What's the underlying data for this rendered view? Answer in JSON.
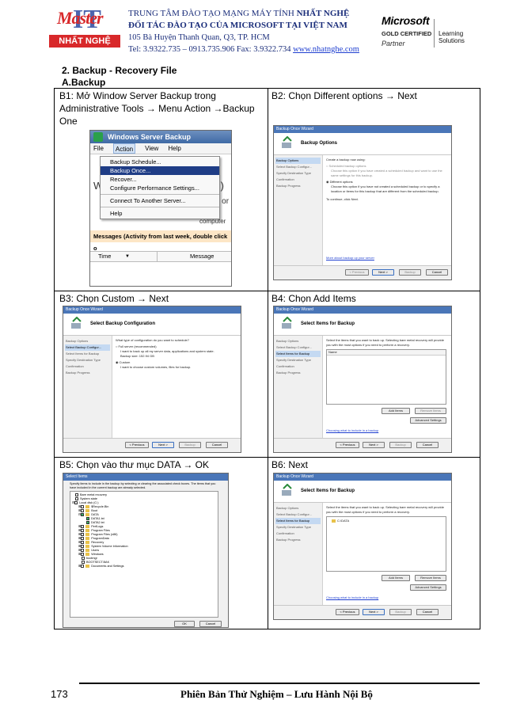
{
  "header": {
    "logo_small": "Master",
    "logo_mark": "IT",
    "logo_band": "NHẤT NGHỆ",
    "line1_prefix": "TRUNG TÂM ĐÀO TẠO MẠNG MÁY TÍNH ",
    "line1_bold": "NHẤT NGHỆ",
    "line2": "ĐỐI TÁC ĐÀO TẠO CỦA MICROSOFT TẠI VIỆT NAM",
    "line3": "105 Bà Huyện Thanh Quan, Q3, TP. HCM",
    "line4_prefix": "Tel: 3.9322.735 – 0913.735.906 Fax: 3.9322.734 ",
    "url": "www.nhatnghe.com",
    "ms_name": "Microsoft",
    "ms_gold": "GOLD CERTIFIED",
    "ms_partner": "Partner",
    "ms_ls": "Learning Solutions"
  },
  "section": {
    "title": "2. Backup - Recovery File",
    "subtitle": "A.Backup"
  },
  "cells": {
    "b1": "B1: Mở Window Server Backup trong Administrative Tools → Menu Action →Backup One",
    "b2": "B2: Chọn Different options → Next",
    "b3": "B3: Chọn Custom → Next",
    "b4": "B4: Chọn Add Items",
    "b5": "B5: Chọn vào thư mục DATA → OK",
    "b6": "B6: Next"
  },
  "shot1": {
    "window_title": "Windows Server Backup",
    "menubar": [
      "File",
      "Action",
      "View",
      "Help"
    ],
    "menu_items": [
      "Backup Schedule...",
      "Backup Once...",
      "Recover...",
      "Configure Performance Settings...",
      "Connect To Another Server...",
      "Help"
    ],
    "behind_text_1": "Win",
    "behind_text_2": "cal)",
    "behind_text_3": "Backup or",
    "behind_text_4": "computer",
    "messages": "Messages (Activity from last week, double click o",
    "col_time": "Time",
    "col_message": "Message"
  },
  "wizard": {
    "title_once": "Backup Once Wizard",
    "nav_b2": [
      "Backup Options",
      "Select Backup Configur...",
      "Specify Destination Type",
      "Confirmation",
      "Backup Progress"
    ],
    "nav_b3": [
      "Backup Options",
      "Select Backup Configur...",
      "Select Items for Backup",
      "Specify Destination Type",
      "Confirmation",
      "Backup Progress"
    ],
    "nav_b4": [
      "Backup Options",
      "Select Backup Configur...",
      "Select Items for Backup",
      "Specify Destination Type",
      "Confirmation",
      "Backup Progress"
    ],
    "b2_heading": "Backup Options",
    "b2_lines": [
      "Create a backup now using:",
      "Scheduled backup options",
      "Choose this option if you have created a scheduled backup and want to use the same settings for this backup.",
      "Different options",
      "Choose this option if you have not created a scheduled backup or to specify a location or items for this backup that are different from the scheduled backup.",
      "To continue, click Next."
    ],
    "b2_link": "More about backup up your server",
    "b3_heading": "Select Backup Configuration",
    "b3_lines": [
      "What type of configuration do you want to schedule?",
      "Full server (recommended)",
      "I want to back up all my server data, applications and system state.",
      "Backup size: 152.94 GB",
      "Custom",
      "I want to choose custom volumes, files for backup."
    ],
    "b4_heading": "Select Items for Backup",
    "b4_text": "Select the items that you want to back up. Selecting bare metal recovery will provide you with the most options if you need to perform a recovery.",
    "b4_col": "Name",
    "b6_item": "C:\\DATA",
    "add_items": "Add Items",
    "remove_items": "Remove Items",
    "advanced": "Advanced Settings",
    "choosing_link": "Choosing what to include in a backup",
    "btn_prev": "< Previous",
    "btn_next": "Next >",
    "btn_backup": "Backup",
    "btn_cancel": "Cancel",
    "btn_ok": "OK"
  },
  "shot5": {
    "title": "Select Items",
    "intro": "Specify items to include in the backup by selecting or clearing the associated check boxes. The items that you have included in the current backup are already selected.",
    "tree": [
      "Bare metal recovery",
      "System state",
      "Local disk (C:)",
      "$Recycle.Bin",
      "Boot",
      "DATA",
      "DATA1.txt",
      "DATA2.txt",
      "PerfLogs",
      "Program Files",
      "Program Files (x86)",
      "ProgramData",
      "Recovery",
      "System Volume Information",
      "Users",
      "Windows",
      "bootmgr",
      "BOOTSECT.BAK",
      "Documents and Settings"
    ]
  },
  "footer": {
    "page_number": "173",
    "text": "Phiên Bản Thử Nghiệm – Lưu Hành Nội Bộ"
  }
}
